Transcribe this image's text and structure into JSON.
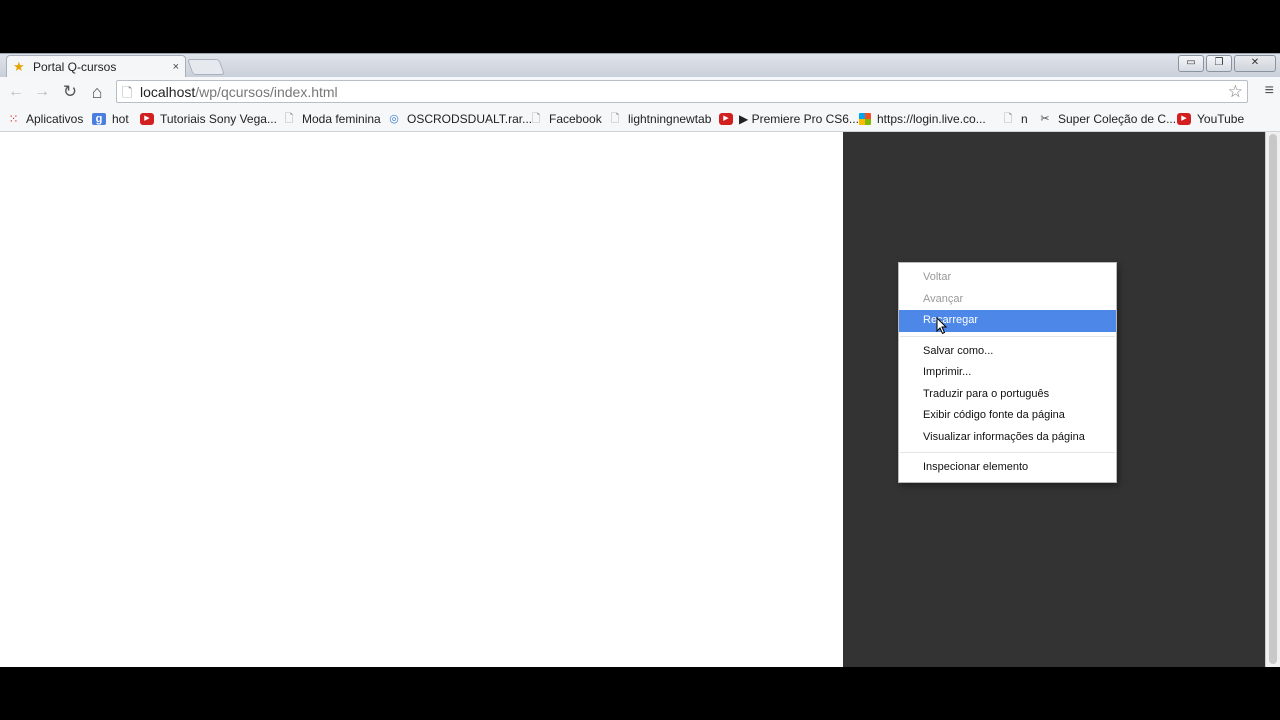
{
  "tab": {
    "title": "Portal Q-cursos",
    "close": "×",
    "favicon": "star-icon"
  },
  "window_controls": {
    "minimize": "▭",
    "maximize": "❐",
    "close": "✕"
  },
  "toolbar": {
    "back": "←",
    "forward": "→",
    "reload": "↻",
    "home": "⌂",
    "url_host": "localhost",
    "url_path": "/wp/qcursos/index.html",
    "star": "☆",
    "menu": "≡"
  },
  "bookmarks": [
    {
      "label": "Aplicativos",
      "icon": "apps-icon",
      "glyph": "⁙"
    },
    {
      "label": "hot",
      "icon": "google-icon",
      "glyph": "g"
    },
    {
      "label": "Tutoriais Sony Vega...",
      "icon": "youtube-icon",
      "glyph": "▶"
    },
    {
      "label": "Moda feminina",
      "icon": "page-icon",
      "glyph": "🗋"
    },
    {
      "label": "OSCRODSDUALT.rar...",
      "icon": "circle-icon",
      "glyph": "◎"
    },
    {
      "label": "Facebook",
      "icon": "page-icon",
      "glyph": "🗋"
    },
    {
      "label": "lightningnewtab",
      "icon": "page-icon",
      "glyph": "🗋"
    },
    {
      "label": "▶ Premiere Pro CS6...",
      "icon": "youtube-icon",
      "glyph": "▶"
    },
    {
      "label": "https://login.live.co...",
      "icon": "microsoft-icon",
      "glyph": ""
    },
    {
      "label": "n",
      "icon": "page-icon",
      "glyph": "🗋"
    },
    {
      "label": "Super Coleção de C...",
      "icon": "scissors-icon",
      "glyph": "✂"
    },
    {
      "label": "YouTube",
      "icon": "youtube-icon",
      "glyph": "▶"
    }
  ],
  "context_menu": {
    "items_top": [
      {
        "label": "Voltar",
        "enabled": false
      },
      {
        "label": "Avançar",
        "enabled": false
      },
      {
        "label": "Recarregar",
        "enabled": true,
        "highlighted": true
      }
    ],
    "items_mid": [
      {
        "label": "Salvar como..."
      },
      {
        "label": "Imprimir..."
      },
      {
        "label": "Traduzir para o português"
      },
      {
        "label": "Exibir código fonte da página"
      },
      {
        "label": "Visualizar informações da página"
      }
    ],
    "items_bottom": [
      {
        "label": "Inspecionar elemento"
      }
    ]
  },
  "colors": {
    "highlight": "#4d88e8",
    "dark_pane": "#333333"
  }
}
